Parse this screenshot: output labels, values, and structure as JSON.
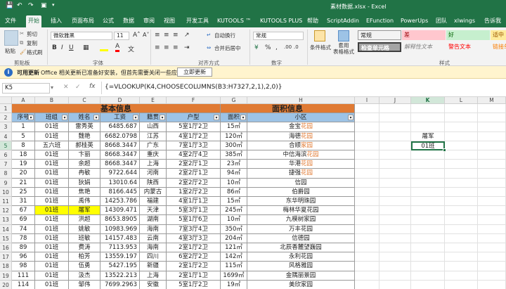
{
  "window": {
    "title": "素材数据.xlsx - Excel"
  },
  "quick_access": {
    "save_icon": "save-icon",
    "undo_icon": "undo-icon",
    "redo_icon": "redo-icon",
    "camera_icon": "camera-icon"
  },
  "tabs": [
    "文件",
    "开始",
    "插入",
    "页面布局",
    "公式",
    "数据",
    "审阅",
    "视图",
    "开发工具",
    "KUTOOLS ™",
    "KUTOOLS PLUS",
    "帮助",
    "ScriptAddin",
    "EFunction",
    "PowerUps",
    "团队",
    "xlwings",
    "告诉我"
  ],
  "active_tab": "开始",
  "ribbon": {
    "clipboard": {
      "paste": "粘贴",
      "cut": "剪切",
      "copy": "复制",
      "format_painter": "格式刷",
      "label": "剪贴板"
    },
    "font": {
      "name": "微软雅黑",
      "size": "11",
      "label": "字体"
    },
    "alignment": {
      "wrap": "自动换行",
      "merge": "合并后居中",
      "label": "对齐方式"
    },
    "number": {
      "format": "常规",
      "label": "数字"
    },
    "styles": {
      "conditional": "条件格式",
      "table": "套用\n表格格式",
      "label": "样式",
      "items": [
        {
          "text": "常规",
          "bg": "#ffffff",
          "fg": "#000000"
        },
        {
          "text": "差",
          "bg": "#ffc7ce",
          "fg": "#9c0006"
        },
        {
          "text": "好",
          "bg": "#c6efce",
          "fg": "#006100"
        },
        {
          "text": "适中",
          "bg": "#ffeb9c",
          "fg": "#9c5700"
        },
        {
          "text": "检查单元格",
          "bg": "#a5a5a5",
          "fg": "#ffffff"
        },
        {
          "text": "解释性文本",
          "bg": "#f3f3f3",
          "fg": "#7f7f7f"
        },
        {
          "text": "警告文本",
          "bg": "#f3f3f3",
          "fg": "#ff0000"
        },
        {
          "text": "链接单",
          "bg": "#f3f3f3",
          "fg": "#fa7d00"
        }
      ]
    }
  },
  "infobar": {
    "title": "可用更新",
    "message": "Office 相关更新已准备好安装，但首先需要关闭一些应用。",
    "button": "立即更新"
  },
  "formula_bar": {
    "name_box": "K5",
    "formula": "{=VLOOKUP(K4,CHOOSECOLUMNS(B3:H7327,2,1),2,0)}"
  },
  "columns": [
    "A",
    "B",
    "C",
    "D",
    "E",
    "F",
    "G",
    "H",
    "I",
    "J",
    "K",
    "L",
    "M"
  ],
  "rows": [
    "1",
    "2",
    "3",
    "4",
    "5",
    "6",
    "7",
    "8",
    "9",
    "10",
    "11",
    "12",
    "13",
    "14",
    "15",
    "16",
    "17",
    "18",
    "19",
    "20"
  ],
  "table": {
    "group1": "基本信息",
    "group2": "面积信息",
    "headers": [
      "序号",
      "班组",
      "姓名",
      "工资",
      "籍贯",
      "户型",
      "面积",
      "小区"
    ],
    "data": [
      [
        "1",
        "01班",
        "雷秀英",
        "6485.687",
        "山西",
        "5室1厅2卫",
        "15㎡",
        "金宝",
        "花园"
      ],
      [
        "5",
        "01班",
        "魏艳",
        "6682.0798",
        "江苏",
        "4室1厅2卫",
        "120㎡",
        "海德",
        "花园"
      ],
      [
        "8",
        "五六班",
        "郝桂英",
        "8668.3447",
        "广东",
        "7室1厅3卫",
        "300㎡",
        "合顺",
        "家园"
      ],
      [
        "18",
        "01班",
        "卞丽",
        "8668.3447",
        "重庆",
        "4室2厅4卫",
        "385㎡",
        "中信海滨",
        "花园"
      ],
      [
        "19",
        "01班",
        "余超",
        "8668.3447",
        "上海",
        "2室2厅1卫",
        "23㎡",
        "华港",
        "花园"
      ],
      [
        "20",
        "01班",
        "冉敏",
        "9722.644",
        "河南",
        "2室2厅1卫",
        "94㎡",
        "捷强",
        "花园"
      ],
      [
        "21",
        "01班",
        "狄娟",
        "13010.64",
        "陕西",
        "2室2厅2卫",
        "10㎡",
        "信园",
        ""
      ],
      [
        "25",
        "01班",
        "焦艳",
        "8166.445",
        "内蒙古",
        "1室2厅2卫",
        "86㎡",
        "伯爵园",
        ""
      ],
      [
        "31",
        "01班",
        "禹伟",
        "14253.786",
        "福建",
        "4室1厅1卫",
        "15㎡",
        "东华明珠园",
        ""
      ],
      [
        "67",
        "01班",
        "屠军",
        "14309.471",
        "天津",
        "5室3厅1卫",
        "245㎡",
        "梅林华夏花园",
        ""
      ],
      [
        "69",
        "01班",
        "洪超",
        "8653.8905",
        "湖南",
        "5室1厅6卫",
        "10㎡",
        "九模树家园",
        ""
      ],
      [
        "74",
        "01班",
        "姚敏",
        "10983.969",
        "海南",
        "7室3厅4卫",
        "350㎡",
        "万丰花园",
        ""
      ],
      [
        "78",
        "01班",
        "班敏",
        "14157.483",
        "云南",
        "4室3厅3卫",
        "204㎡",
        "信德园",
        ""
      ],
      [
        "89",
        "01班",
        "费涛",
        "7113.953",
        "海南",
        "2室1厅2卫",
        "121㎡",
        "北辰香麓望巍园",
        ""
      ],
      [
        "96",
        "01班",
        "柏芳",
        "13559.197",
        "四川",
        "6室2厅2卫",
        "142㎡",
        "永利花园",
        ""
      ],
      [
        "98",
        "01班",
        "伍勇",
        "5427.195",
        "新疆",
        "2室1厅2卫",
        "115㎡",
        "风格雅园",
        ""
      ],
      [
        "111",
        "01班",
        "汲杰",
        "13522.213",
        "上海",
        "2室1厅1卫",
        "1699㎡",
        "金隅丽景园",
        ""
      ],
      [
        "114",
        "01班",
        "邹伟",
        "7699.2963",
        "安徽",
        "5室1厅2卫",
        "19㎡",
        "美欣家园",
        ""
      ]
    ]
  },
  "lookup": {
    "k4": "屠军",
    "k5": "01班"
  },
  "colors": {
    "accent": "#217346",
    "group_header": "#e07a33",
    "col_header": "#9dc3e6",
    "highlight": "#ffff00"
  }
}
